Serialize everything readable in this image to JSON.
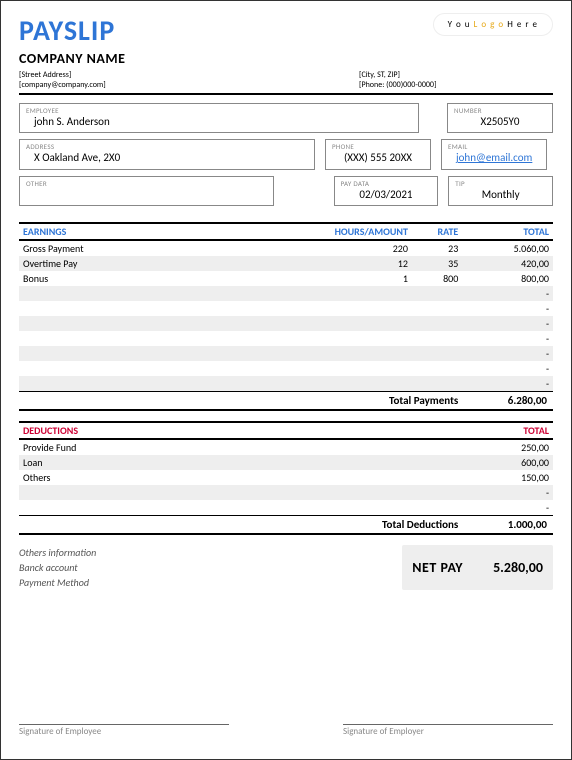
{
  "header": {
    "title": "PAYSLIP",
    "logo_pre": "Y o u ",
    "logo_mid": "L o g o",
    "logo_post": " H e r e",
    "company": "COMPANY NAME",
    "street": "[Street Address]",
    "email_placeholder": "[company@company.com]",
    "city": "[City, ST, ZIP]",
    "phone": "[Phone: (000)000-0000]"
  },
  "info": {
    "employee_lbl": "EMPLOYEE",
    "employee": "john S. Anderson",
    "number_lbl": "NUMBER",
    "number": "X2505Y0",
    "address_lbl": "ADDRESS",
    "address": "X Oakland Ave, 2X0",
    "phone_lbl": "PHONE",
    "phone": "(XXX) 555 20XX",
    "email_lbl": "EMAIL",
    "email": "john@email.com",
    "other_lbl": "OTHER",
    "other": "",
    "paydata_lbl": "PAY DATA",
    "paydata": "02/03/2021",
    "tip_lbl": "TIP",
    "tip": "Monthly"
  },
  "earnings": {
    "col_name": "EARNINGS",
    "col_hours": "HOURS/AMOUNT",
    "col_rate": "RATE",
    "col_total": "TOTAL",
    "rows": [
      {
        "name": "Gross Payment",
        "hours": "220",
        "rate": "23",
        "total": "5.060,00"
      },
      {
        "name": "Overtime Pay",
        "hours": "12",
        "rate": "35",
        "total": "420,00"
      },
      {
        "name": "Bonus",
        "hours": "1",
        "rate": "800",
        "total": "800,00"
      },
      {
        "name": "",
        "hours": "",
        "rate": "",
        "total": "-"
      },
      {
        "name": "",
        "hours": "",
        "rate": "",
        "total": "-"
      },
      {
        "name": "",
        "hours": "",
        "rate": "",
        "total": "-"
      },
      {
        "name": "",
        "hours": "",
        "rate": "",
        "total": "-"
      },
      {
        "name": "",
        "hours": "",
        "rate": "",
        "total": "-"
      },
      {
        "name": "",
        "hours": "",
        "rate": "",
        "total": "-"
      },
      {
        "name": "",
        "hours": "",
        "rate": "",
        "total": "-"
      }
    ],
    "total_lbl": "Total Payments",
    "total_val": "6.280,00"
  },
  "deductions": {
    "col_name": "DEDUCTIONS",
    "col_total": "TOTAL",
    "rows": [
      {
        "name": "Provide Fund",
        "total": "250,00"
      },
      {
        "name": "Loan",
        "total": "600,00"
      },
      {
        "name": "Others",
        "total": "150,00"
      },
      {
        "name": "",
        "total": "-"
      },
      {
        "name": "",
        "total": "-"
      }
    ],
    "total_lbl": "Total Deductions",
    "total_val": "1.000,00"
  },
  "others": {
    "line1": "Others information",
    "line2": "Banck account",
    "line3": "Payment Method"
  },
  "netpay": {
    "label": "NET PAY",
    "value": "5.280,00"
  },
  "sig": {
    "employee": "Signature of Employee",
    "employer": "Signature of Employer"
  }
}
